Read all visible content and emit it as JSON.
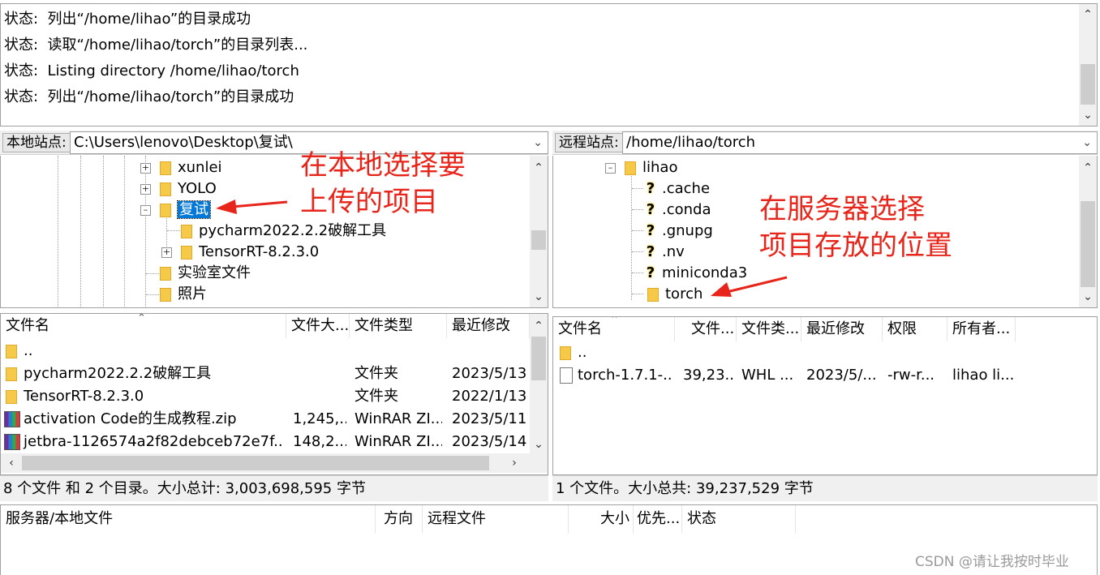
{
  "log": {
    "lines": [
      {
        "prefix": "状态:",
        "text": "列出“/home/lihao”的目录成功"
      },
      {
        "prefix": "状态:",
        "text": "读取“/home/lihao/torch”的目录列表..."
      },
      {
        "prefix": "状态:",
        "text": "Listing directory /home/lihao/torch"
      },
      {
        "prefix": "状态:",
        "text": "列出“/home/lihao/torch”的目录成功"
      }
    ]
  },
  "local": {
    "site_label": "本地站点:",
    "site_path": "C:\\Users\\lenovo\\Desktop\\复试\\",
    "tree": [
      {
        "name": "xunlei",
        "expander": "+"
      },
      {
        "name": "YOLO",
        "expander": "+"
      },
      {
        "name": "复试",
        "expander": "-",
        "selected": true
      },
      {
        "name": "pycharm2022.2.2破解工具"
      },
      {
        "name": "TensorRT-8.2.3.0",
        "expander": "+"
      },
      {
        "name": "实验室文件"
      },
      {
        "name": "照片"
      }
    ],
    "columns": [
      "文件名",
      "文件大...",
      "文件类型",
      "最近修改"
    ],
    "files": [
      {
        "name": "..",
        "size": "",
        "type": "",
        "modified": "",
        "icon": "folder-icon"
      },
      {
        "name": "pycharm2022.2.2破解工具",
        "size": "",
        "type": "文件夹",
        "modified": "2023/5/13",
        "icon": "folder-icon"
      },
      {
        "name": "TensorRT-8.2.3.0",
        "size": "",
        "type": "文件夹",
        "modified": "2022/1/13",
        "icon": "folder-icon"
      },
      {
        "name": "activation Code的生成教程.zip",
        "size": "1,245,...",
        "type": "WinRAR ZI...",
        "modified": "2023/5/11",
        "icon": "winrar-icon"
      },
      {
        "name": "jetbra-1126574a2f82debceb72e7f...",
        "size": "148,2...",
        "type": "WinRAR ZI...",
        "modified": "2023/5/14",
        "icon": "winrar-icon"
      }
    ],
    "status": "8 个文件 和 2 个目录。大小总计: 3,003,698,595 字节"
  },
  "remote": {
    "site_label": "远程站点:",
    "site_path": "/home/lihao/torch",
    "tree": [
      {
        "name": "lihao",
        "kind": "folder",
        "expander": "-"
      },
      {
        "name": ".cache",
        "kind": "unknown"
      },
      {
        "name": ".conda",
        "kind": "unknown"
      },
      {
        "name": ".gnupg",
        "kind": "unknown"
      },
      {
        "name": ".nv",
        "kind": "unknown"
      },
      {
        "name": "miniconda3",
        "kind": "unknown"
      },
      {
        "name": "torch",
        "kind": "folder"
      }
    ],
    "columns": [
      "文件名",
      "文件...",
      "文件类...",
      "最近修改",
      "权限",
      "所有者..."
    ],
    "files": [
      {
        "name": "..",
        "size": "",
        "type": "",
        "modified": "",
        "perm": "",
        "owner": "",
        "icon": "folder-icon"
      },
      {
        "name": "torch-1.7.1-...",
        "size": "39,23...",
        "type": "WHL ...",
        "modified": "2023/5/...",
        "perm": "-rw-r...",
        "owner": "lihao li...",
        "icon": "file-icon"
      }
    ],
    "status": "1 个文件。大小总共: 39,237,529 字节"
  },
  "queue": {
    "columns": [
      "服务器/本地文件",
      "方向",
      "远程文件",
      "大小",
      "优先...",
      "状态"
    ]
  },
  "annotations": {
    "local_line1": "在本地选择要",
    "local_line2": "上传的项目",
    "remote_line1": "在服务器选择",
    "remote_line2": "项目存放的位置"
  },
  "watermark": "CSDN @请让我按时毕业",
  "colors": {
    "annotation": "#e8251b",
    "selection": "#0078d7",
    "folder": "#f7c948"
  }
}
